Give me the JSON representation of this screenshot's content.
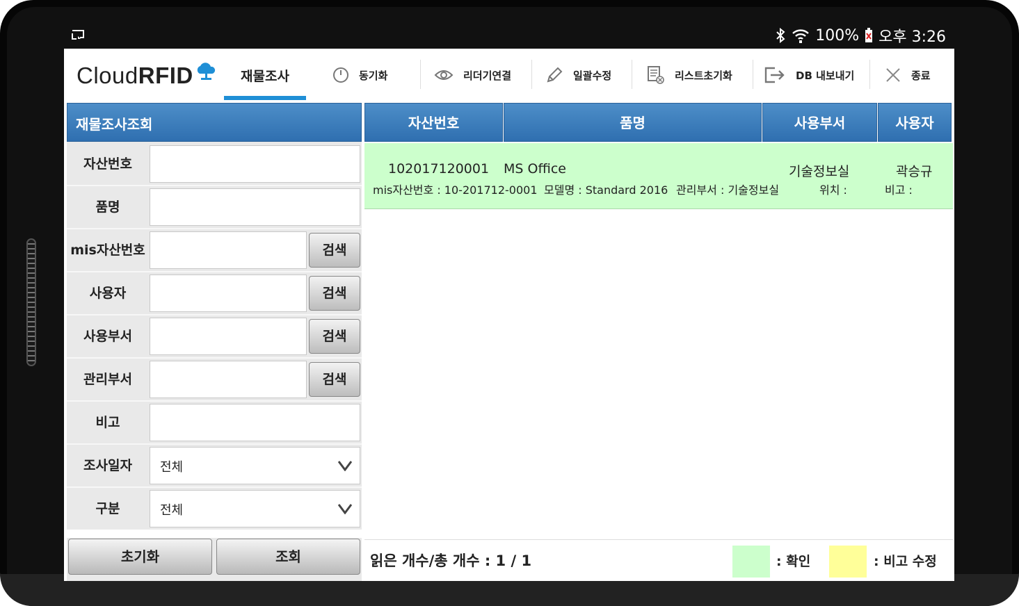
{
  "status_bar": {
    "battery": "100%",
    "time": "오후 3:26"
  },
  "app": {
    "logo_light": "Cloud",
    "logo_bold": "RFID"
  },
  "tabs": {
    "active": "재물조사"
  },
  "menu": [
    {
      "label": "동기화",
      "icon": "clock-icon"
    },
    {
      "label": "리더기연결",
      "icon": "eye-icon"
    },
    {
      "label": "일괄수정",
      "icon": "pencil-icon"
    },
    {
      "label": "리스트초기화",
      "icon": "list-clear-icon"
    },
    {
      "label": "DB 내보내기",
      "icon": "export-icon"
    },
    {
      "label": "종료",
      "icon": "close-icon"
    }
  ],
  "search_panel": {
    "title": "재물조사조회",
    "fields": {
      "asset_no": {
        "label": "자산번호",
        "value": ""
      },
      "item_name": {
        "label": "품명",
        "value": ""
      },
      "mis_asset_no": {
        "label": "mis자산번호",
        "value": ""
      },
      "user": {
        "label": "사용자",
        "value": ""
      },
      "user_dept": {
        "label": "사용부서",
        "value": ""
      },
      "mgmt_dept": {
        "label": "관리부서",
        "value": ""
      },
      "note": {
        "label": "비고",
        "value": ""
      },
      "survey_date": {
        "label": "조사일자",
        "value": "전체"
      },
      "category": {
        "label": "구분",
        "value": "전체"
      }
    },
    "search_button": "검색",
    "reset_button": "초기화",
    "query_button": "조회"
  },
  "table": {
    "headers": [
      "자산번호",
      "품명",
      "사용부서",
      "사용자"
    ],
    "rows": [
      {
        "asset_no": "102017120001",
        "item_name": "MS Office",
        "user_dept": "기술정보실",
        "user": "곽승규",
        "mis": "mis자산번호 : 10-201712-0001",
        "model": "모델명 : Standard 2016",
        "mgmt": "관리부서 : 기술정보실",
        "location": "위치 :",
        "note": "비고 :"
      }
    ]
  },
  "footer": {
    "count_text": "읽은 개수/총 개수 : 1 / 1",
    "legend_confirm": ":  확인",
    "legend_note_edit": ": 비고 수정"
  },
  "colors": {
    "header_blue": "#3a7dbf",
    "confirm_green": "#ccffcc",
    "note_yellow": "#ffff99",
    "tab_accent": "#1f8fd6"
  }
}
